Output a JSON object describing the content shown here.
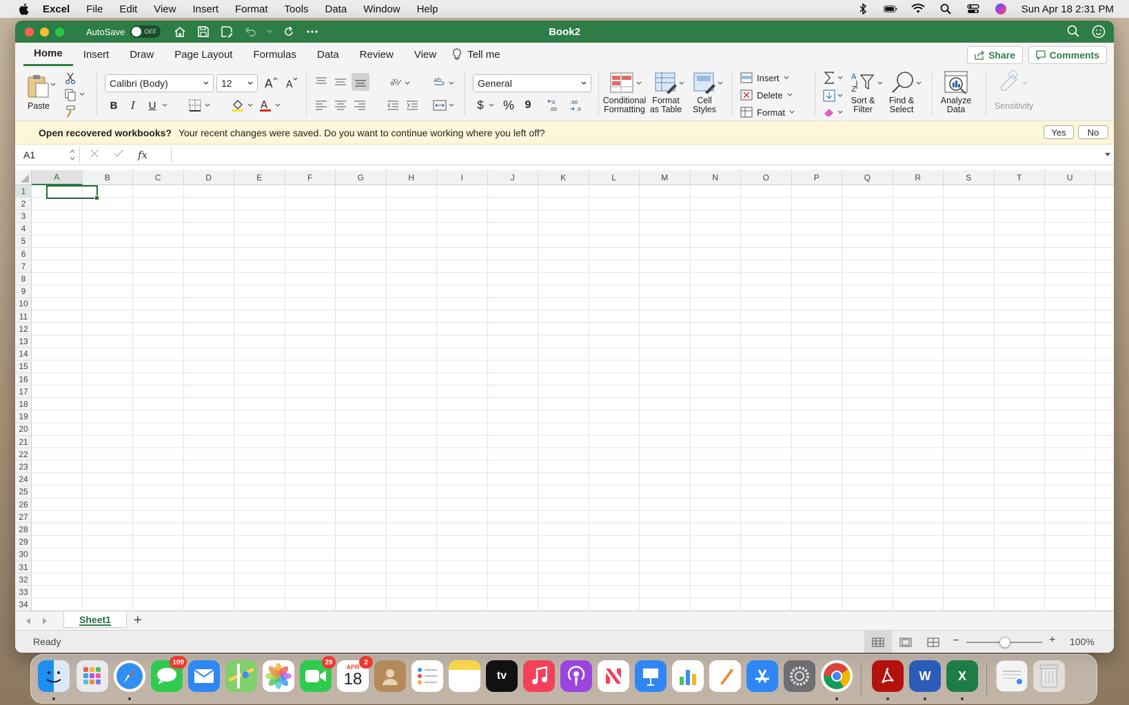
{
  "menubar": {
    "app_name": "Excel",
    "items": [
      "File",
      "Edit",
      "View",
      "Insert",
      "Format",
      "Tools",
      "Data",
      "Window",
      "Help"
    ],
    "clock": "Sun Apr 18  2:31 PM"
  },
  "window": {
    "title": "Book2",
    "autosave_label": "AutoSave",
    "autosave_state": "OFF"
  },
  "ribbon_tabs": {
    "items": [
      "Home",
      "Insert",
      "Draw",
      "Page Layout",
      "Formulas",
      "Data",
      "Review",
      "View"
    ],
    "tell_me": "Tell me",
    "share": "Share",
    "comments": "Comments"
  },
  "ribbon": {
    "paste": "Paste",
    "font_name": "Calibri (Body)",
    "font_size": "12",
    "number_format": "General",
    "conditional_formatting_1": "Conditional",
    "conditional_formatting_2": "Formatting",
    "format_as_table_1": "Format",
    "format_as_table_2": "as Table",
    "cell_styles_1": "Cell",
    "cell_styles_2": "Styles",
    "insert": "Insert",
    "delete": "Delete",
    "format": "Format",
    "sort_filter_1": "Sort &",
    "sort_filter_2": "Filter",
    "find_select_1": "Find &",
    "find_select_2": "Select",
    "analyze_data_1": "Analyze",
    "analyze_data_2": "Data",
    "sensitivity": "Sensitivity",
    "bold": "B",
    "italic": "I",
    "underline": "U",
    "dollar": "$",
    "percent": "%",
    "comma": "9"
  },
  "infobar": {
    "title": "Open recovered workbooks?",
    "message": "Your recent changes were saved. Do you want to continue working where you left off?",
    "yes": "Yes",
    "no": "No"
  },
  "formula_bar": {
    "name_box": "A1",
    "fx": "fx",
    "formula": ""
  },
  "grid": {
    "columns": [
      "A",
      "B",
      "C",
      "D",
      "E",
      "F",
      "G",
      "H",
      "I",
      "J",
      "K",
      "L",
      "M",
      "N",
      "O",
      "P",
      "Q",
      "R",
      "S",
      "T",
      "U"
    ],
    "rows": [
      "1",
      "2",
      "3",
      "4",
      "5",
      "6",
      "7",
      "8",
      "9",
      "10",
      "11",
      "12",
      "13",
      "14",
      "15",
      "16",
      "17",
      "18",
      "19",
      "20",
      "21",
      "22",
      "23",
      "24",
      "25",
      "26",
      "27",
      "28",
      "29",
      "30",
      "31",
      "32",
      "33",
      "34"
    ],
    "active_cell": "A1"
  },
  "sheets": {
    "tabs": [
      "Sheet1"
    ],
    "add": "+"
  },
  "status": {
    "ready": "Ready",
    "zoom": "100%",
    "zoom_minus": "−",
    "zoom_plus": "+"
  },
  "dock": {
    "badges": {
      "messages": "109",
      "facetime": "29",
      "calendar": "2"
    },
    "calendar_month": "APR",
    "calendar_day": "18",
    "tv": "tv",
    "word": "W",
    "excel": "X"
  }
}
